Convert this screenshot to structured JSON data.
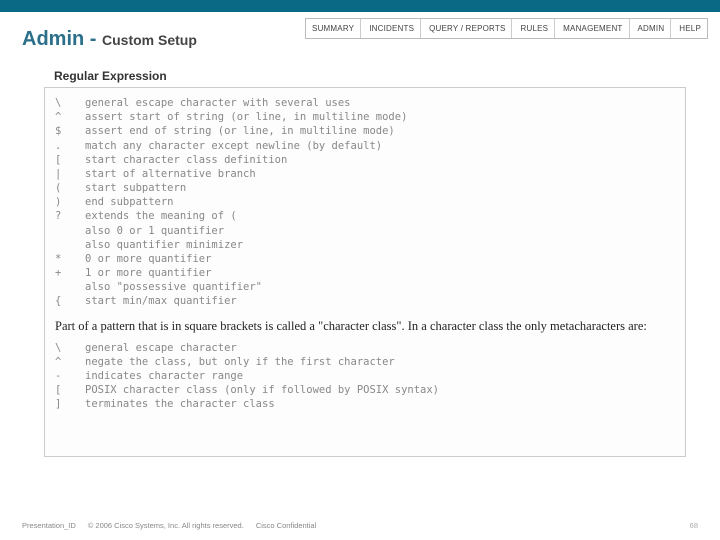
{
  "menu": [
    "SUMMARY",
    "INCIDENTS",
    "QUERY / REPORTS",
    "RULES",
    "MANAGEMENT",
    "ADMIN",
    "HELP"
  ],
  "title": {
    "main": "Admin - ",
    "sub": "Custom Setup"
  },
  "subhead": "Regular Expression",
  "meta1": [
    {
      "s": "\\",
      "d": "general escape character with several uses"
    },
    {
      "s": "^",
      "d": "assert start of string (or line, in multiline mode)"
    },
    {
      "s": "$",
      "d": "assert end of string (or line, in multiline mode)"
    },
    {
      "s": ".",
      "d": "match any character except newline (by default)"
    },
    {
      "s": "[",
      "d": "start character class definition"
    },
    {
      "s": "|",
      "d": "start of alternative branch"
    },
    {
      "s": "(",
      "d": "start subpattern"
    },
    {
      "s": ")",
      "d": "end subpattern"
    },
    {
      "s": "?",
      "d": "extends the meaning of ("
    },
    {
      "s": "",
      "d": "also 0 or 1 quantifier"
    },
    {
      "s": "",
      "d": "also quantifier minimizer"
    },
    {
      "s": "*",
      "d": "0 or more quantifier"
    },
    {
      "s": "+",
      "d": "1 or more quantifier"
    },
    {
      "s": "",
      "d": "also \"possessive quantifier\""
    },
    {
      "s": "{",
      "d": "start min/max quantifier"
    }
  ],
  "plaintext": "Part of a pattern that is in square brackets is called a \"character class\". In a character class the only metacharacters are:",
  "meta2": [
    {
      "s": "\\",
      "d": "general escape character"
    },
    {
      "s": "^",
      "d": "negate the class, but only if the first character"
    },
    {
      "s": "-",
      "d": "indicates character range"
    },
    {
      "s": "[",
      "d": "POSIX character class (only if followed by POSIX syntax)"
    },
    {
      "s": "]",
      "d": "terminates the character class"
    }
  ],
  "footer": {
    "pres": "Presentation_ID",
    "copy": "© 2006 Cisco Systems, Inc. All rights reserved.",
    "conf": "Cisco Confidential",
    "page": "68"
  }
}
